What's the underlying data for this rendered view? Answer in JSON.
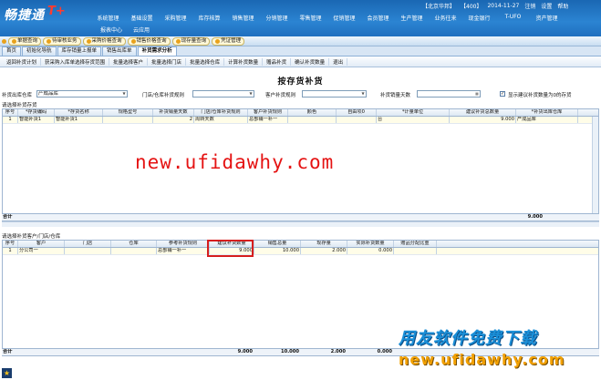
{
  "header": {
    "logo_text": "畅捷通",
    "logo_plus": "T+",
    "top_info": [
      "【北京华邦】",
      "【400】",
      "2014-11-27",
      "注销",
      "设置",
      "帮助"
    ],
    "main_menu": [
      "系统管理",
      "基础设置",
      "采购管理",
      "库存核算",
      "销售管理",
      "分销管理",
      "零售管理",
      "促销管理",
      "会员管理",
      "生产管理",
      "业务往来",
      "现金银行",
      "T-UFO",
      "资产管理"
    ],
    "sub_menu": [
      "报表中心",
      "云应用"
    ]
  },
  "quick_tabs": [
    "单据查询",
    "待审核业务",
    "采购价格查询",
    "销售价格查询",
    "现存量查询",
    "凭证管理"
  ],
  "doc_tabs": [
    {
      "label": "首页"
    },
    {
      "label": "初始化导航"
    },
    {
      "label": "库存销量上报单"
    },
    {
      "label": "销售出库单"
    },
    {
      "label": "补货需求分析"
    }
  ],
  "toolbar": [
    "返回补货计划",
    "获采购入库单选择存货范围",
    "批量选择客户",
    "批量选择门店",
    "批量选择仓库",
    "计算补货数量",
    "赠品补货",
    "确认补货数量",
    "退出"
  ],
  "page_title": "按存货补货",
  "filters": {
    "warehouse_label": "补货出库仓库",
    "warehouse_value": "产成品库",
    "store_label": "门店/仓库补货规则",
    "store_value": "",
    "customer_label": "客户补货规则",
    "customer_value": "",
    "days_label": "补货销量天数",
    "days_value": "",
    "show_zero_label": "显示建议补货数量为0的存货",
    "show_zero_checked": "✓"
  },
  "section1_label": "请选择补货存货",
  "grid1": {
    "headers": [
      "序号",
      "*存货编码",
      "*存货名称",
      "规格型号",
      "补货销量天数",
      "门店/仓库补货规则",
      "客户补货规则",
      "颜色",
      "自由项0",
      "*计量单位",
      "建议补货总数量",
      "*补货出库仓库"
    ],
    "rows": [
      [
        "1",
        "智能补货1",
        "智能补货1",
        "",
        "2",
        "周转天数",
        "总部铺一补一",
        "",
        "",
        "台",
        "9.000",
        "产成品库"
      ]
    ],
    "total_label": "合计",
    "total_value": "9.000"
  },
  "section2_label": "请选择补货客户/门店/仓库",
  "grid2": {
    "headers": [
      "序号",
      "客户",
      "门店",
      "仓库",
      "参考补货规则",
      "建议补货数量",
      "销售总量",
      "现存量",
      "实际补货数量",
      "赠品分配比重"
    ],
    "rows": [
      [
        "1",
        "分公司一",
        "",
        "",
        "总部铺一补一",
        "9.000",
        "10.000",
        "2.000",
        "0.000",
        ""
      ]
    ],
    "total_label": "合计",
    "totals": [
      "9.000",
      "10.000",
      "2.000",
      "0.000"
    ]
  },
  "watermark": "new.ufidawhy.com",
  "brand_cn": "用友软件免费下载",
  "brand_url": "new.ufidawhy.com",
  "bottom_icon": "star-icon",
  "colors": {
    "header_blue": "#2b84d2",
    "watermark_red": "#e51313",
    "brand_blue": "#1a8fd8",
    "brand_orange": "#f2a000",
    "row_yellow": "#fffde8"
  }
}
